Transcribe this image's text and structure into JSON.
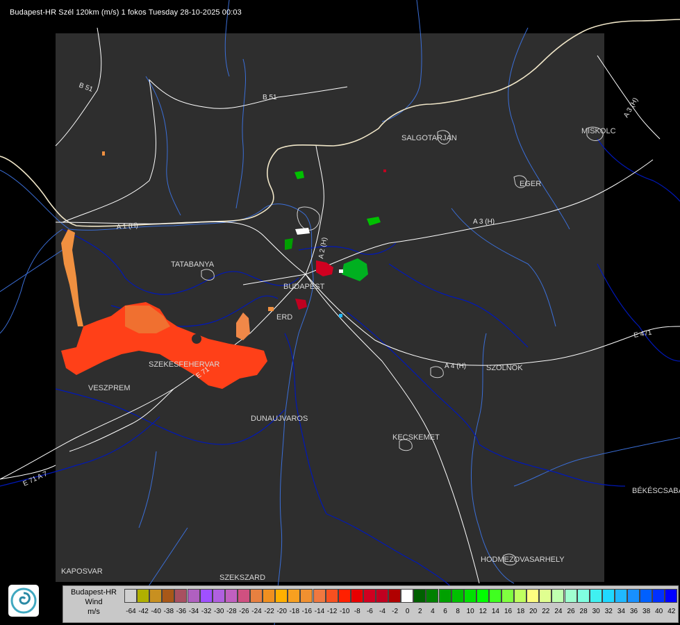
{
  "header": {
    "title": "Budapest-HR Szél 120km (m/s) 1 fokos Tuesday 28-10-2025 00:03"
  },
  "map": {
    "colors": {
      "background": "#000000",
      "radar_area": "#2e2e2e",
      "water": "#3b6fd8",
      "border": "#f0e6c8",
      "road": "#ffffff",
      "admin": "#0018b8"
    },
    "cities": [
      {
        "id": "salgotarjan",
        "name": "SALGOTARJAN"
      },
      {
        "id": "miskolc",
        "name": "MISKOLC"
      },
      {
        "id": "eger",
        "name": "EGER"
      },
      {
        "id": "tatabanya",
        "name": "TATABANYA"
      },
      {
        "id": "budapest",
        "name": "BUDAPEST"
      },
      {
        "id": "erd",
        "name": "ERD"
      },
      {
        "id": "szekesfehervar",
        "name": "SZEKESFEHERVAR"
      },
      {
        "id": "veszprem",
        "name": "VESZPREM"
      },
      {
        "id": "dunaujvaros",
        "name": "DUNAUJVAROS"
      },
      {
        "id": "kecskemet",
        "name": "KECSKEMET"
      },
      {
        "id": "szolnok",
        "name": "SZOLNOK"
      },
      {
        "id": "bekescsaba",
        "name": "BÉKÉSCSABA"
      },
      {
        "id": "hodmezovasarhely",
        "name": "HODMEZOVASARHELY"
      },
      {
        "id": "kaposvar",
        "name": "KAPOSVAR"
      },
      {
        "id": "szekszard",
        "name": "SZEKSZARD"
      }
    ],
    "roads": [
      {
        "id": "b51-west",
        "name": "B 51"
      },
      {
        "id": "b51-north",
        "name": "B 51"
      },
      {
        "id": "a1",
        "name": "A 1 (H)"
      },
      {
        "id": "a2",
        "name": "A 2 (H)"
      },
      {
        "id": "a3",
        "name": "A 3 (H)"
      },
      {
        "id": "a3-ne",
        "name": "A 3 (H)"
      },
      {
        "id": "a4",
        "name": "A 4 (H)"
      },
      {
        "id": "e71",
        "name": "E 71"
      },
      {
        "id": "e71-sw",
        "name": "E 71 A 7"
      },
      {
        "id": "e471",
        "name": "E 471"
      }
    ]
  },
  "legend": {
    "line1": "Budapest-HR",
    "line2": "Wind",
    "line3": "m/s",
    "ticks": [
      "-64",
      "-42",
      "-40",
      "-38",
      "-36",
      "-34",
      "-32",
      "-30",
      "-28",
      "-26",
      "-24",
      "-22",
      "-20",
      "-18",
      "-16",
      "-14",
      "-12",
      "-10",
      "-8",
      "-6",
      "-4",
      "-2",
      "0",
      "2",
      "4",
      "6",
      "8",
      "10",
      "12",
      "14",
      "16",
      "18",
      "20",
      "22",
      "24",
      "26",
      "28",
      "30",
      "32",
      "34",
      "36",
      "38",
      "40",
      "42"
    ],
    "colors": [
      "#d0d0d0",
      "#b0b000",
      "#c89020",
      "#a85818",
      "#a85060",
      "#b060c0",
      "#a050ff",
      "#b060e0",
      "#c060c0",
      "#d05080",
      "#e88040",
      "#f09020",
      "#ffb000",
      "#f8a020",
      "#f09030",
      "#f07840",
      "#f85020",
      "#ff2000",
      "#e80000",
      "#d00020",
      "#c00020",
      "#b00000",
      "#ffffff",
      "#006000",
      "#008000",
      "#00a000",
      "#00c000",
      "#00e000",
      "#00ff00",
      "#40ff20",
      "#80ff40",
      "#c0ff60",
      "#ffff80",
      "#e0ff90",
      "#c0ffb0",
      "#a0ffd0",
      "#80ffe0",
      "#40f0f0",
      "#20d8ff",
      "#20b8ff",
      "#1890ff",
      "#0060ff",
      "#0030ff",
      "#0000ff"
    ]
  }
}
